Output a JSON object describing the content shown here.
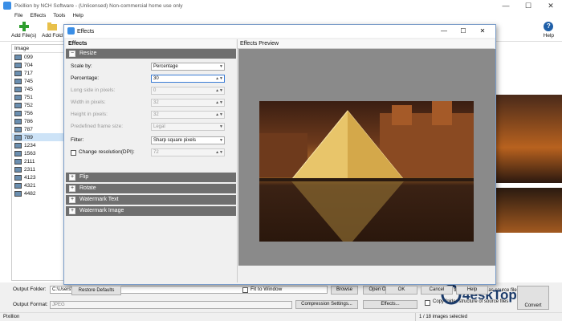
{
  "app": {
    "title": "Pixillion by NCH Software - (Unlicensed) Non-commercial home use only",
    "controls": [
      "—",
      "☐",
      "✕"
    ]
  },
  "menu": [
    "File",
    "Effects",
    "Tools",
    "Help"
  ],
  "toolbar": {
    "add_files": "Add File(s)",
    "add_folder": "Add Fold",
    "help": "Help"
  },
  "image_list": {
    "header": "Image",
    "items": [
      "099",
      "704",
      "717",
      "745",
      "745",
      "751",
      "752",
      "756",
      "786",
      "787",
      "789",
      "1234",
      "1563",
      "2111",
      "2311",
      "4123",
      "4321",
      "4482"
    ],
    "selected_index": 10
  },
  "bottom": {
    "output_folder_label": "Output Folder:",
    "output_folder_value": "C:\\Users\\Public\\Pictures",
    "browse": "Browse",
    "open_output_folder": "Open Output Folder",
    "output_format_label": "Output Format:",
    "output_format_value": "JPEG",
    "compression_settings": "Compression Settings...",
    "effects": "Effects...",
    "output_same_folder": "Output to the same folder as source files",
    "copy_folder_structure": "Copy folder structure of source files",
    "convert": "Convert"
  },
  "status": {
    "left": "Pixillion",
    "right": "1 / 18 images selected"
  },
  "dialog": {
    "title": "Effects",
    "controls": [
      "—",
      "☐",
      "✕"
    ],
    "effects_header": "Effects",
    "preview_header": "Effects Preview",
    "sections": {
      "resize": "Resize",
      "flip": "Flip",
      "rotate": "Rotate",
      "watermark_text": "Watermark Text",
      "watermark_image": "Watermark Image"
    },
    "resize": {
      "scale_by_label": "Scale by:",
      "scale_by_value": "Percentage",
      "percentage_label": "Percentage:",
      "percentage_value": "30",
      "long_side_label": "Long side in pixels:",
      "long_side_value": "0",
      "width_label": "Width in pixels:",
      "width_value": "32",
      "height_label": "Height in pixels:",
      "height_value": "32",
      "frame_size_label": "Predefined frame size:",
      "frame_size_value": "Legal",
      "filter_label": "Filter:",
      "filter_value": "Sharp square pixels",
      "change_resolution_label": "Change resolution(DPI):",
      "change_resolution_value": "72"
    },
    "restore_defaults": "Restore Defaults",
    "fit_to_window": "Fit to Window",
    "ok": "OK",
    "cancel": "Cancel",
    "help": "Help"
  },
  "watermark": "4eskTop"
}
